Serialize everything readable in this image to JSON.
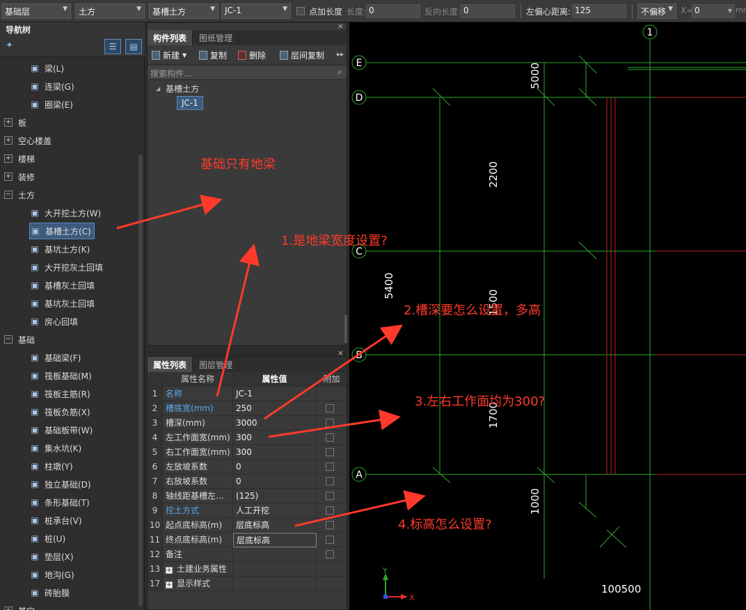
{
  "toolbar": {
    "floor_select": "基础层",
    "category_select": "土方",
    "type_select": "基槽土方",
    "component_select": "JC-1",
    "add_length_label": "点加长度",
    "length_label": "长度:",
    "length_value": "0",
    "reverse_length_label": "反向长度:",
    "reverse_length_value": "0",
    "left_offset_label": "左偏心距离:",
    "left_offset_value": "125",
    "offset_select": "不偏移",
    "x_label": "X=",
    "x_value": "0",
    "unit": "mm"
  },
  "nav_tree": {
    "title": "导航树",
    "items": [
      {
        "label": "梁(L)",
        "icon": "beam-icon",
        "kind": "child"
      },
      {
        "label": "连梁(G)",
        "icon": "coupling-beam-icon",
        "kind": "child"
      },
      {
        "label": "圈梁(E)",
        "icon": "ring-beam-icon",
        "kind": "child"
      },
      {
        "label": "板",
        "icon": "expand-icon",
        "kind": "group"
      },
      {
        "label": "空心楼盖",
        "icon": "expand-icon",
        "kind": "group"
      },
      {
        "label": "楼梯",
        "icon": "expand-icon",
        "kind": "group"
      },
      {
        "label": "装修",
        "icon": "expand-icon",
        "kind": "group"
      },
      {
        "label": "土方",
        "icon": "folder-open-icon",
        "kind": "group"
      },
      {
        "label": "大开挖土方(W)",
        "icon": "excavation-icon",
        "kind": "child"
      },
      {
        "label": "基槽土方(C)",
        "icon": "trench-icon",
        "kind": "child",
        "selected": true
      },
      {
        "label": "基坑土方(K)",
        "icon": "pit-icon",
        "kind": "child"
      },
      {
        "label": "大开挖灰土回填",
        "icon": "backfill-icon",
        "kind": "child"
      },
      {
        "label": "基槽灰土回填",
        "icon": "trench-backfill-icon",
        "kind": "child"
      },
      {
        "label": "基坑灰土回填",
        "icon": "pit-backfill-icon",
        "kind": "child"
      },
      {
        "label": "房心回填",
        "icon": "room-backfill-icon",
        "kind": "child"
      },
      {
        "label": "基础",
        "icon": "folder-open-icon",
        "kind": "group"
      },
      {
        "label": "基础梁(F)",
        "icon": "foundation-beam-icon",
        "kind": "child"
      },
      {
        "label": "筏板基础(M)",
        "icon": "raft-icon",
        "kind": "child"
      },
      {
        "label": "筏板主筋(R)",
        "icon": "raft-main-rebar-icon",
        "kind": "child"
      },
      {
        "label": "筏板负筋(X)",
        "icon": "raft-neg-rebar-icon",
        "kind": "child"
      },
      {
        "label": "基础板带(W)",
        "icon": "slab-strip-icon",
        "kind": "child"
      },
      {
        "label": "集水坑(K)",
        "icon": "sump-icon",
        "kind": "child"
      },
      {
        "label": "柱墩(Y)",
        "icon": "pier-icon",
        "kind": "child"
      },
      {
        "label": "独立基础(D)",
        "icon": "isolated-footing-icon",
        "kind": "child"
      },
      {
        "label": "条形基础(T)",
        "icon": "strip-footing-icon",
        "kind": "child"
      },
      {
        "label": "桩承台(V)",
        "icon": "pile-cap-icon",
        "kind": "child"
      },
      {
        "label": "桩(U)",
        "icon": "pile-icon",
        "kind": "child"
      },
      {
        "label": "垫层(X)",
        "icon": "cushion-icon",
        "kind": "child"
      },
      {
        "label": "地沟(G)",
        "icon": "ditch-icon",
        "kind": "child"
      },
      {
        "label": "砖胎膜",
        "icon": "brick-mold-icon",
        "kind": "child"
      },
      {
        "label": "其它",
        "icon": "expand-icon",
        "kind": "group"
      }
    ]
  },
  "component_panel": {
    "tabs": [
      "构件列表",
      "图纸管理"
    ],
    "actions": [
      "新建",
      "复制",
      "删除",
      "层间复制"
    ],
    "search_placeholder": "搜索构件...",
    "tree_parent": "基槽土方",
    "tree_child": "JC-1"
  },
  "property_panel": {
    "tabs": [
      "属性列表",
      "图层管理"
    ],
    "headers": [
      "属性名称",
      "属性值",
      "附加"
    ],
    "rows": [
      {
        "n": "1",
        "name": "名称",
        "value": "JC-1",
        "blue": true,
        "check": false
      },
      {
        "n": "2",
        "name": "槽底宽(mm)",
        "value": "250",
        "blue": true,
        "check": true
      },
      {
        "n": "3",
        "name": "槽深(mm)",
        "value": "3000",
        "blue": false,
        "check": true
      },
      {
        "n": "4",
        "name": "左工作面宽(mm)",
        "value": "300",
        "blue": false,
        "check": true
      },
      {
        "n": "5",
        "name": "右工作面宽(mm)",
        "value": "300",
        "blue": false,
        "check": true
      },
      {
        "n": "6",
        "name": "左放坡系数",
        "value": "0",
        "blue": false,
        "check": true
      },
      {
        "n": "7",
        "name": "右放坡系数",
        "value": "0",
        "blue": false,
        "check": true
      },
      {
        "n": "8",
        "name": "轴线距基槽左...",
        "value": "(125)",
        "blue": false,
        "check": true
      },
      {
        "n": "9",
        "name": "挖土方式",
        "value": "人工开挖",
        "blue": true,
        "check": true
      },
      {
        "n": "10",
        "name": "起点底标高(m)",
        "value": "层底标高",
        "blue": false,
        "check": true
      },
      {
        "n": "11",
        "name": "终点底标高(m)",
        "value": "层底标高",
        "blue": false,
        "check": true
      },
      {
        "n": "12",
        "name": "备注",
        "value": "",
        "blue": false,
        "check": true
      },
      {
        "n": "13",
        "name": "土建业务属性",
        "value": "",
        "blue": false,
        "check": false,
        "expand": true
      },
      {
        "n": "17",
        "name": "显示样式",
        "value": "",
        "blue": false,
        "check": false,
        "expand": true
      }
    ]
  },
  "canvas": {
    "axis_top": "1",
    "axes_left": [
      "E",
      "D",
      "C",
      "B",
      "A"
    ],
    "dims": [
      "5000",
      "2200",
      "5400",
      "1500",
      "1700",
      "1000",
      "100500"
    ],
    "axis_x": "X"
  },
  "annotations": [
    "基础只有地梁",
    "1.是地梁宽度设置?",
    "2.槽深要怎么设置，多高",
    "3.左右工作面均为300?",
    "4.标高怎么设置?"
  ],
  "colors": {
    "annotation": "#ff3a2a",
    "grid": "#2ea82e",
    "red_line": "#c02020",
    "selection": "#3c5a7c"
  }
}
